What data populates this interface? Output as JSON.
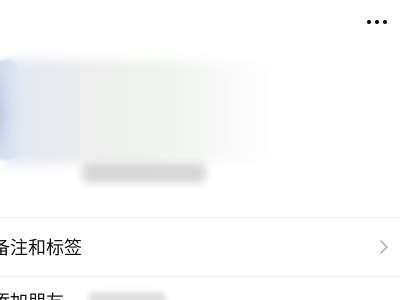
{
  "header": {
    "more_icon": "more-horizontal-icon"
  },
  "profile": {
    "card_state": "blurred"
  },
  "rows": [
    {
      "label": "备注和标签",
      "icon": "chevron-right-icon"
    }
  ],
  "partial_row": {
    "label": "添加朋友"
  },
  "colors": {
    "background": "#ffffff",
    "text": "#111111",
    "divider": "#ececec",
    "chevron": "#b3b3b3"
  }
}
